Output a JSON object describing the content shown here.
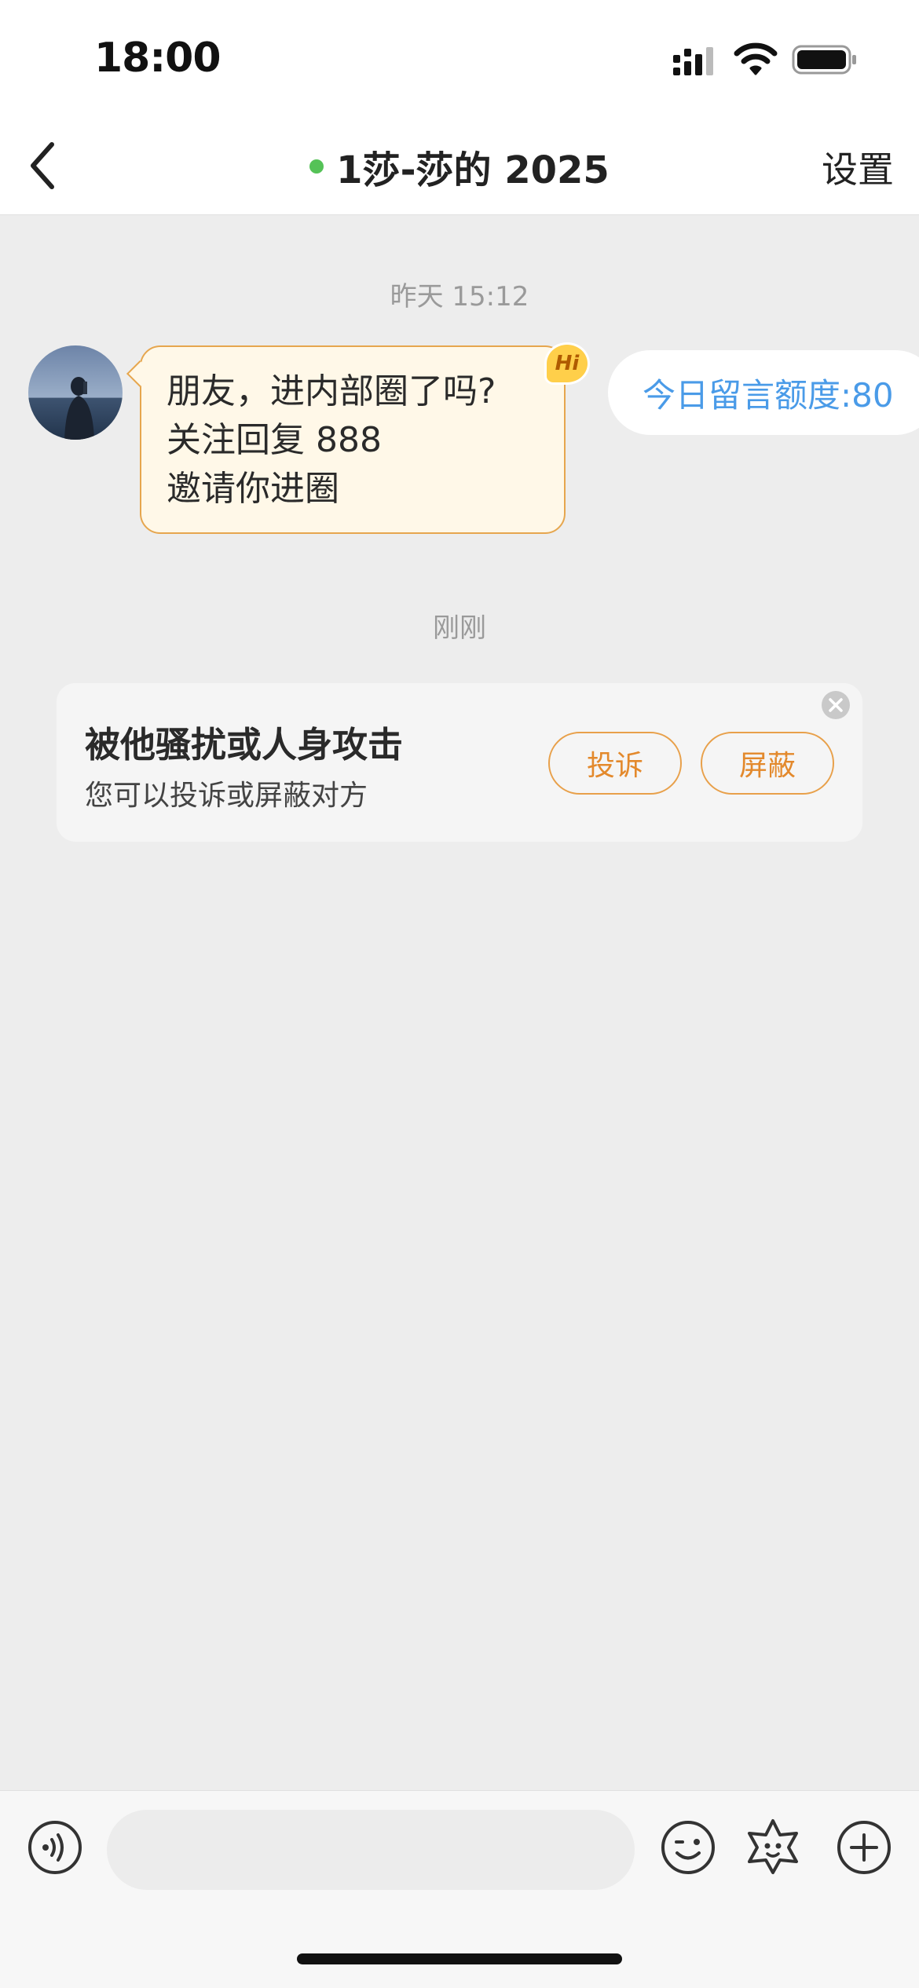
{
  "status_bar": {
    "time": "18:00"
  },
  "header": {
    "back_icon": "chevron-left-icon",
    "online_status_color": "#55c257",
    "title": "1莎-莎的 2025",
    "settings_label": "设置"
  },
  "chat": {
    "yesterday_timestamp": "昨天 15:12",
    "incoming_message": {
      "lines": [
        "朋友，进内部圈了吗?",
        "关注回复 888",
        "邀请你进圈"
      ],
      "badge": "Hi"
    },
    "quota_label": "今日留言额度:80",
    "just_now_timestamp": "刚刚"
  },
  "report_card": {
    "title": "被他骚扰或人身攻击",
    "subtitle": "您可以投诉或屏蔽对方",
    "complain_label": "投诉",
    "block_label": "屏蔽",
    "accent_color": "#e3892c"
  },
  "input_bar": {
    "placeholder": "",
    "icons": [
      "voice-icon",
      "emoji-icon",
      "sticker-icon",
      "plus-icon"
    ]
  }
}
